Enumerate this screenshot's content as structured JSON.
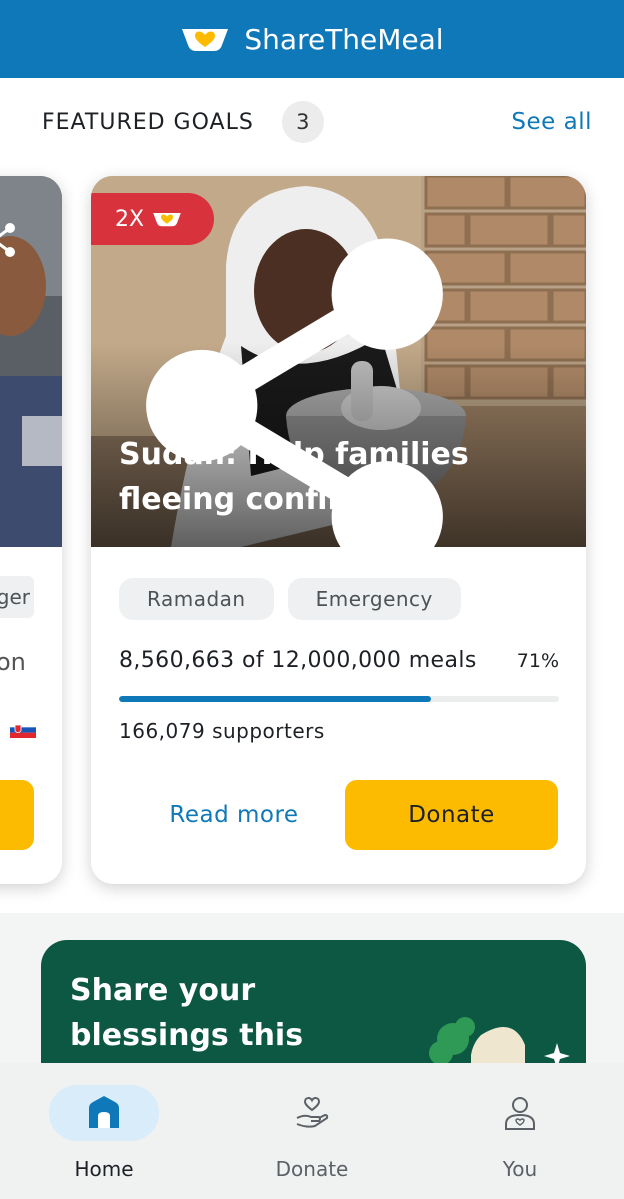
{
  "header": {
    "app_name": "ShareTheMeal",
    "logo_icon": "bowl-heart-icon"
  },
  "featured": {
    "title": "FEATURED GOALS",
    "count": "3",
    "see_all": "See all"
  },
  "left_card": {
    "tag_partial": "ger",
    "text_partial": "on",
    "flag_icon": "slovakia-flag-icon"
  },
  "main_card": {
    "badge": "2X",
    "title": "Sudan: Help families fleeing conflict",
    "tags": [
      "Ramadan",
      "Emergency"
    ],
    "meals_text": "8,560,663 of 12,000,000 meals",
    "percent": "71%",
    "progress_fraction": 0.71,
    "supporters": "166,079 supporters",
    "read_more": "Read more",
    "donate": "Donate"
  },
  "promo": {
    "text": "Share your blessings this"
  },
  "nav": {
    "items": [
      {
        "label": "Home",
        "icon": "home-icon",
        "active": true
      },
      {
        "label": "Donate",
        "icon": "hand-heart-icon",
        "active": false
      },
      {
        "label": "You",
        "icon": "user-icon",
        "active": false
      }
    ]
  },
  "colors": {
    "brand_blue": "#0f78b9",
    "donate_yellow": "#fdbb00",
    "badge_red": "#d8323d",
    "promo_green": "#0d5843"
  }
}
